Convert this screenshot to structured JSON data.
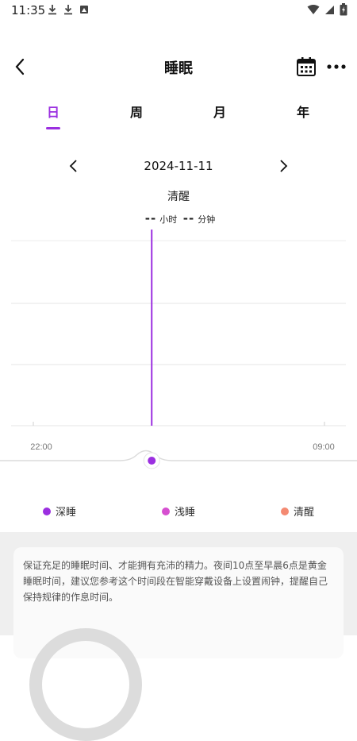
{
  "status_bar": {
    "time": "11:35",
    "left_icons": [
      "download-icon",
      "download-icon",
      "image-icon"
    ],
    "right_icons": [
      "wifi-icon",
      "signal-icon",
      "battery-charging-icon"
    ]
  },
  "header": {
    "title": "睡眠",
    "back_icon": "back-chevron-icon",
    "calendar_icon": "calendar-icon",
    "more_icon": "more-dots-icon"
  },
  "tabs": [
    {
      "label": "日",
      "active": true
    },
    {
      "label": "周",
      "active": false
    },
    {
      "label": "月",
      "active": false
    },
    {
      "label": "年",
      "active": false
    }
  ],
  "date_nav": {
    "date": "2024-11-11"
  },
  "summary": {
    "state": "清醒",
    "hours_value": "--",
    "hours_unit": "小时",
    "minutes_value": "--",
    "minutes_unit": "分钟"
  },
  "chart_data": {
    "type": "bar",
    "x_start_label": "22:00",
    "x_end_label": "09:00",
    "cursor_fraction": 0.42,
    "series": [],
    "grid": true
  },
  "legend": [
    {
      "label": "深睡",
      "color": "#9b2fe0"
    },
    {
      "label": "浅睡",
      "color": "#d64fd0"
    },
    {
      "label": "清醒",
      "color": "#f48a72"
    }
  ],
  "tip": {
    "text": "保证充足的睡眠时间、才能拥有充沛的精力。夜间10点至早晨6点是黄金睡眠时间，建议您参考这个时间段在智能穿戴设备上设置闹钟，提醒自己保持规律的作息时间。"
  },
  "colors": {
    "accent": "#9b2fe0"
  }
}
